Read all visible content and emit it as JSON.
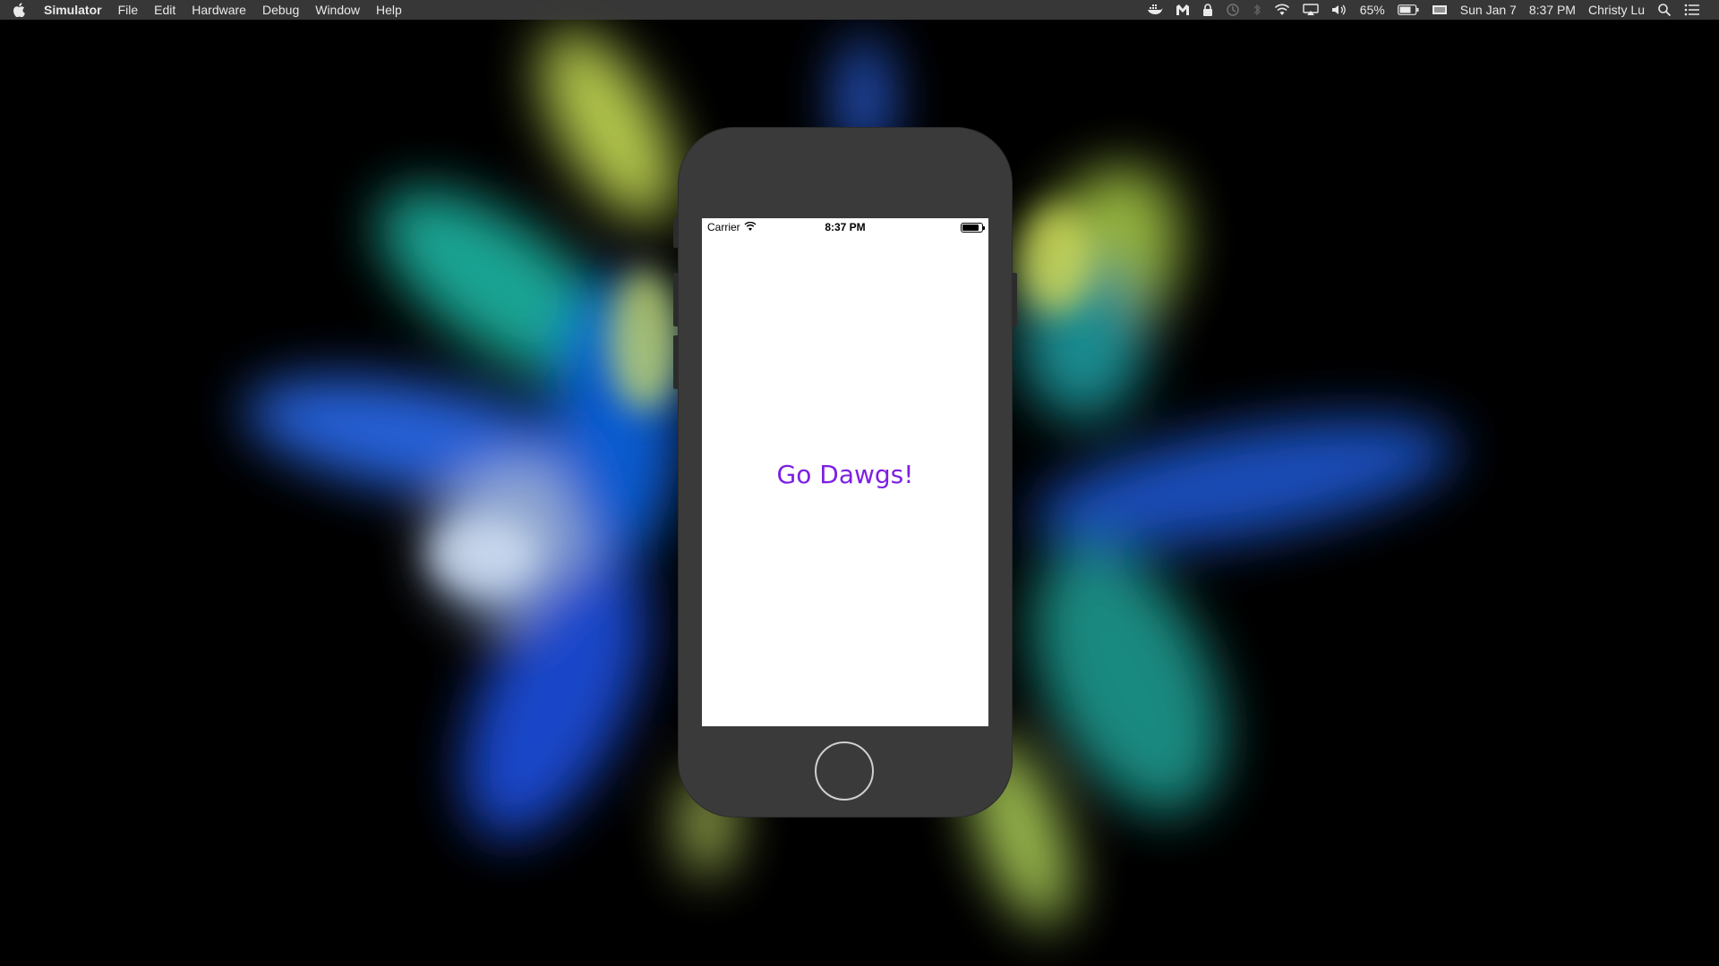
{
  "menubar": {
    "app_name": "Simulator",
    "menus": [
      "File",
      "Edit",
      "Hardware",
      "Debug",
      "Window",
      "Help"
    ],
    "battery_percent": "65%",
    "date": "Sun Jan 7",
    "time": "8:37 PM",
    "user": "Christy Lu",
    "tray_icons": [
      "docker-icon",
      "malwarebytes-icon",
      "lock-icon",
      "time-machine-icon",
      "bluetooth-icon",
      "wifi-icon",
      "airplay-icon",
      "volume-icon",
      "battery-icon",
      "keyboard-input-icon",
      "spotlight-icon",
      "notification-center-icon"
    ]
  },
  "simulator": {
    "status_bar": {
      "carrier": "Carrier",
      "time": "8:37 PM",
      "battery_level": 0.85
    },
    "app": {
      "label_text": "Go Dawgs!",
      "label_color": "#7d1fe3"
    }
  },
  "colors": {
    "menubar_bg": "#3c3c3c",
    "device_body": "#3a3a3a",
    "screen_bg": "#ffffff"
  }
}
